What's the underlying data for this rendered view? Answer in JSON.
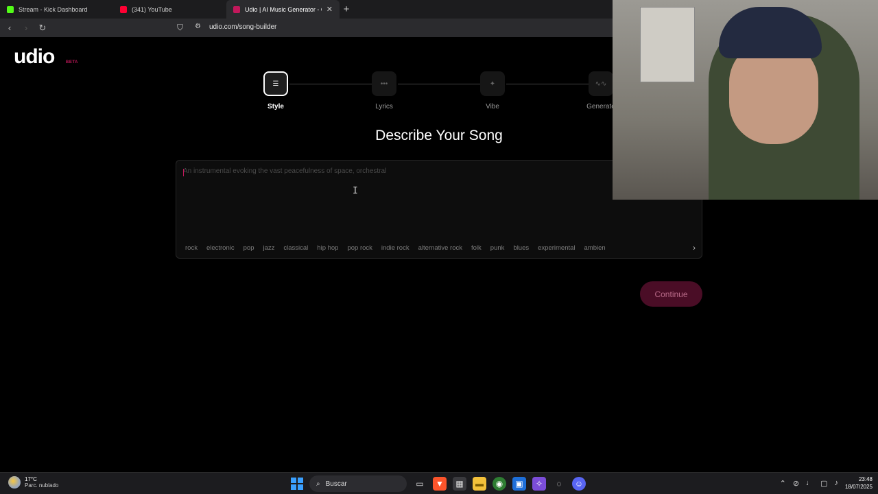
{
  "browser": {
    "tabs": [
      {
        "title": "Stream - Kick Dashboard",
        "favicon_color": "#53fc18",
        "active": false
      },
      {
        "title": "(341) YouTube",
        "favicon_color": "#ff0033",
        "active": false
      },
      {
        "title": "Udio | AI Music Generator - Offic",
        "favicon_color": "#c2185b",
        "active": true
      }
    ],
    "url": "udio.com/song-builder"
  },
  "page": {
    "logo": "udio",
    "logo_badge": "BETA",
    "steps": [
      {
        "label": "Style",
        "icon": "style-icon",
        "active": true
      },
      {
        "label": "Lyrics",
        "icon": "lyrics-icon",
        "active": false
      },
      {
        "label": "Vibe",
        "icon": "vibe-icon",
        "active": false
      },
      {
        "label": "Generate",
        "icon": "waveform-icon",
        "active": false
      }
    ],
    "heading": "Describe Your Song",
    "prompt_placeholder": "An instrumental evoking the vast peacefulness of space, orchestral",
    "prompt_value": "",
    "tags": [
      "rock",
      "electronic",
      "pop",
      "jazz",
      "classical",
      "hip hop",
      "pop rock",
      "indie rock",
      "alternative rock",
      "folk",
      "punk",
      "blues",
      "experimental",
      "ambien"
    ],
    "continue_label": "Continue"
  },
  "taskbar": {
    "weather_temp": "17°C",
    "weather_desc": "Parc. nublado",
    "search_label": "Buscar",
    "time": "23:48",
    "date": "18/07/2025"
  },
  "colors": {
    "accent": "#c2185b",
    "continue_bg": "#4a0d26"
  }
}
